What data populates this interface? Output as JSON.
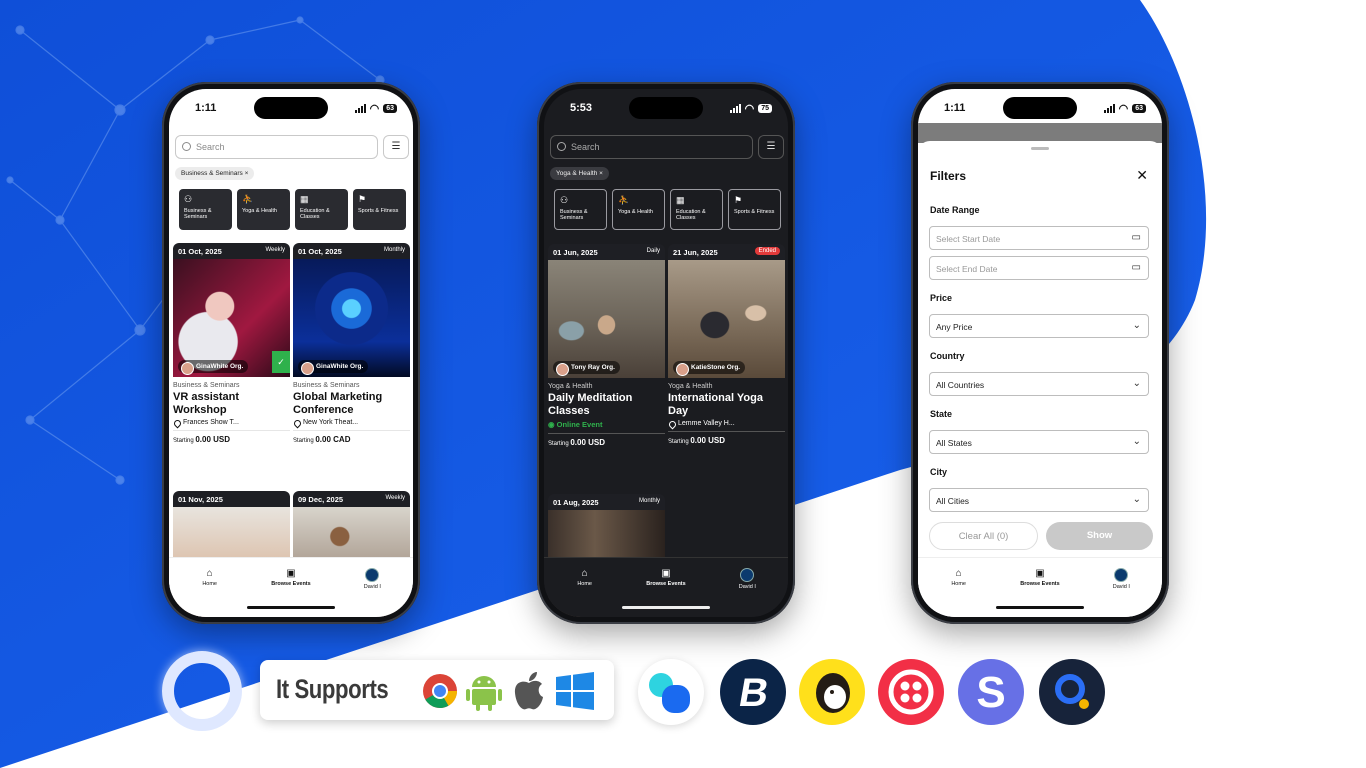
{
  "phone_light": {
    "time": "1:11",
    "battery": "63",
    "search_placeholder": "Search",
    "active_chip": "Business & Seminars ×",
    "categories": [
      "Business & Seminars",
      "Yoga & Health",
      "Education & Classes",
      "Sports & Fitness"
    ],
    "events": [
      {
        "date": "01 Oct, 2025",
        "repeat": "Weekly",
        "org": "GinaWhite Org.",
        "category": "Business & Seminars",
        "title": "VR assistant Workshop",
        "location": "Frances Show T...",
        "price_prefix": "Starting",
        "price": "0.00 USD"
      },
      {
        "date": "01 Oct, 2025",
        "repeat": "Monthly",
        "org": "GinaWhite Org.",
        "category": "Business & Seminars",
        "title": "Global Marketing Conference",
        "location": "New York Theat...",
        "price_prefix": "Starting",
        "price": "0.00 CAD"
      },
      {
        "date": "01 Nov, 2025",
        "repeat": ""
      },
      {
        "date": "09 Dec, 2025",
        "repeat": "Weekly"
      }
    ],
    "nav": [
      "Home",
      "Browse Events",
      "David I"
    ]
  },
  "phone_dark": {
    "time": "5:53",
    "battery": "75",
    "search_placeholder": "Search",
    "active_chip": "Yoga & Health ×",
    "categories": [
      "Business & Seminars",
      "Yoga & Health",
      "Education & Classes",
      "Sports & Fitness"
    ],
    "events": [
      {
        "date": "01 Jun, 2025",
        "repeat": "Daily",
        "org": "Tony Ray Org.",
        "category": "Yoga & Health",
        "title": "Daily Meditation Classes",
        "status": "Online Event",
        "price_prefix": "Starting",
        "price": "0.00 USD"
      },
      {
        "date": "21 Jun, 2025",
        "repeat": "Ended",
        "org": "KatieStone Org.",
        "category": "Yoga & Health",
        "title": "International Yoga Day",
        "location": "Lemme Valley H...",
        "price_prefix": "Starting",
        "price": "0.00 USD"
      },
      {
        "date": "01 Aug, 2025",
        "repeat": "Monthly"
      }
    ],
    "nav": [
      "Home",
      "Browse Events",
      "David I"
    ]
  },
  "phone_filters": {
    "time": "1:11",
    "battery": "63",
    "title": "Filters",
    "date_range_label": "Date Range",
    "start_date_placeholder": "Select Start Date",
    "end_date_placeholder": "Select End Date",
    "price_label": "Price",
    "price_value": "Any Price",
    "country_label": "Country",
    "country_value": "All Countries",
    "state_label": "State",
    "state_value": "All States",
    "city_label": "City",
    "city_value": "All Cities",
    "clear_label": "Clear All (0)",
    "show_label": "Show",
    "nav": [
      "Home",
      "Browse Events",
      "David I"
    ]
  },
  "support": {
    "label": "It Supports",
    "platforms": [
      "chrome-icon",
      "android-icon",
      "apple-icon",
      "windows-icon"
    ],
    "integrations": [
      "zoom-connect-icon",
      "bitcoin-icon",
      "mailchimp-icon",
      "twilio-icon",
      "stripe-s-icon",
      "search-q-icon"
    ]
  },
  "colors": {
    "brand_blue": "#1a5fe6",
    "online_green": "#2fb14c",
    "ended_red": "#e23a3a"
  }
}
